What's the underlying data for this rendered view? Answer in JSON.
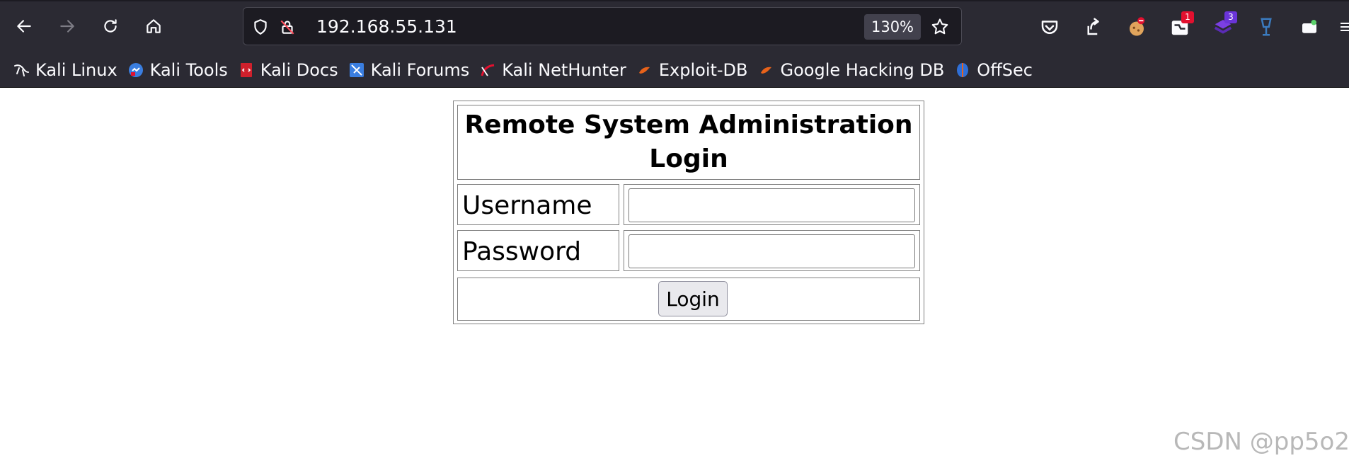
{
  "browser": {
    "url": "192.168.55.131",
    "zoom": "130%",
    "badges": {
      "ublock": "1",
      "extension_purple": "3"
    }
  },
  "bookmarks": [
    {
      "label": "Kali Linux",
      "icon": "kali-dragon-icon"
    },
    {
      "label": "Kali Tools",
      "icon": "kali-tools-icon"
    },
    {
      "label": "Kali Docs",
      "icon": "kali-docs-icon"
    },
    {
      "label": "Kali Forums",
      "icon": "kali-forums-icon"
    },
    {
      "label": "Kali NetHunter",
      "icon": "nethunter-icon"
    },
    {
      "label": "Exploit-DB",
      "icon": "exploit-db-icon"
    },
    {
      "label": "Google Hacking DB",
      "icon": "ghdb-icon"
    },
    {
      "label": "OffSec",
      "icon": "offsec-icon"
    }
  ],
  "page": {
    "title": "Remote System Administration Login",
    "username_label": "Username",
    "password_label": "Password",
    "username_value": "",
    "password_value": "",
    "login_button": "Login"
  },
  "watermark": "CSDN @pp5o2",
  "colors": {
    "chrome_bg": "#2b2a33",
    "urlbar_bg": "#1c1b22",
    "page_bg": "#ffffff"
  }
}
